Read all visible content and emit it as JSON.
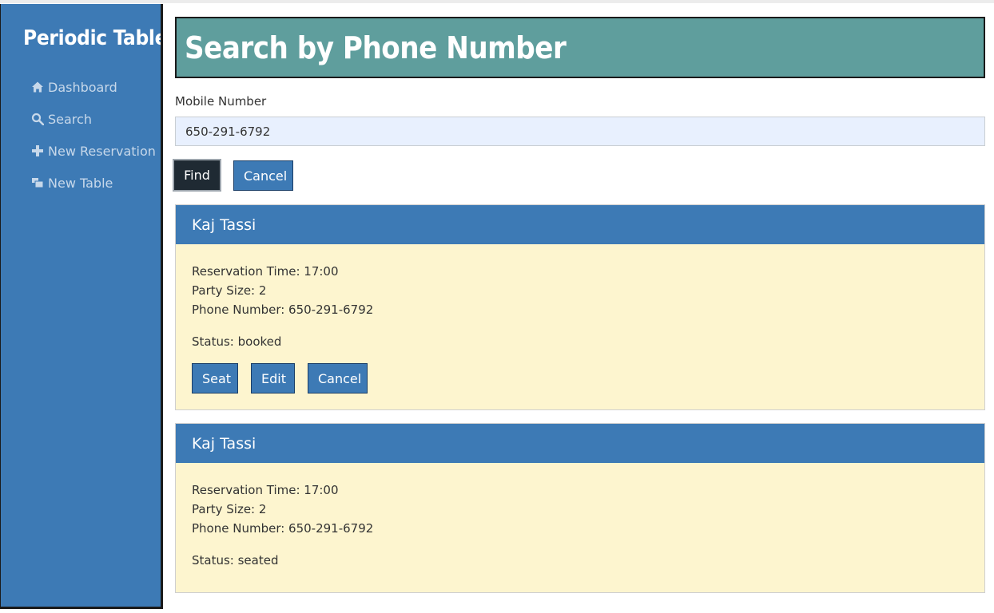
{
  "app": {
    "brand": "Periodic Tables"
  },
  "sidebar": {
    "items": [
      {
        "label": "Dashboard",
        "icon": "home-icon"
      },
      {
        "label": "Search",
        "icon": "search-icon"
      },
      {
        "label": "New Reservation",
        "icon": "plus-icon"
      },
      {
        "label": "New Table",
        "icon": "table-icon"
      }
    ]
  },
  "page": {
    "title": "Search by Phone Number"
  },
  "search": {
    "label": "Mobile Number",
    "value": "650-291-6792",
    "find_label": "Find",
    "cancel_label": "Cancel"
  },
  "reservations": [
    {
      "name": "Kaj Tassi",
      "time_text": "Reservation Time: 17:00",
      "party_text": "Party Size: 2",
      "phone_text": "Phone Number: 650-291-6792",
      "status_text": "Status: booked",
      "seat_label": "Seat",
      "edit_label": "Edit",
      "cancel_label": "Cancel"
    },
    {
      "name": "Kaj Tassi",
      "time_text": "Reservation Time: 17:00",
      "party_text": "Party Size: 2",
      "phone_text": "Phone Number: 650-291-6792",
      "status_text": "Status: seated"
    }
  ],
  "colors": {
    "sidebar": "#3d7ab5",
    "header": "#5f9e9d",
    "card_head": "#3d7ab5",
    "card_body": "#fdf5cf",
    "find_button": "#1f2a33"
  }
}
